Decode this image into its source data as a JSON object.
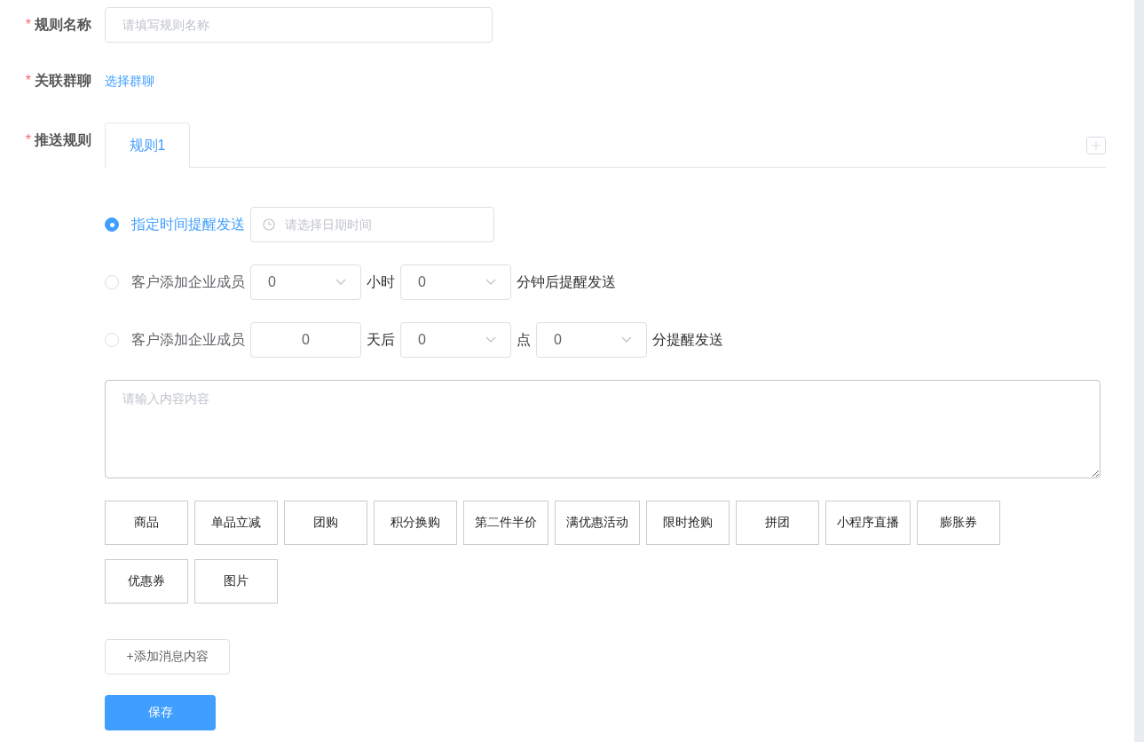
{
  "rule_name": {
    "required_mark": "*",
    "label": "规则名称",
    "placeholder": "请填写规则名称"
  },
  "group_chat": {
    "required_mark": "*",
    "label": "关联群聊",
    "link": "选择群聊"
  },
  "push_rules": {
    "required_mark": "*",
    "label": "推送规则",
    "tabs": [
      {
        "label": "规则1",
        "selected": true
      }
    ],
    "options": [
      {
        "label": "指定时间提醒发送",
        "selected": true,
        "parts": [
          {
            "kind": "datetime",
            "placeholder": "请选择日期时间"
          }
        ]
      },
      {
        "label": "客户添加企业成员",
        "selected": false,
        "parts": [
          {
            "kind": "select",
            "value": "0"
          },
          {
            "kind": "text",
            "text": "小时"
          },
          {
            "kind": "select",
            "value": "0"
          },
          {
            "kind": "text",
            "text": "分钟后提醒发送"
          }
        ]
      },
      {
        "label": "客户添加企业成员",
        "selected": false,
        "parts": [
          {
            "kind": "input",
            "value": "0"
          },
          {
            "kind": "text",
            "text": "天后"
          },
          {
            "kind": "select",
            "value": "0"
          },
          {
            "kind": "text",
            "text": "点"
          },
          {
            "kind": "select",
            "value": "0"
          },
          {
            "kind": "text",
            "text": "分提醒发送"
          }
        ]
      }
    ],
    "content_placeholder": "请输入内容内容",
    "content_types": [
      "商品",
      "单品立减",
      "团购",
      "积分换购",
      "第二件半价",
      "满优惠活动",
      "限时抢购",
      "拼团",
      "小程序直播",
      "膨胀券",
      "优惠券",
      "图片"
    ],
    "add_content": "+添加消息内容"
  },
  "save": "保存"
}
